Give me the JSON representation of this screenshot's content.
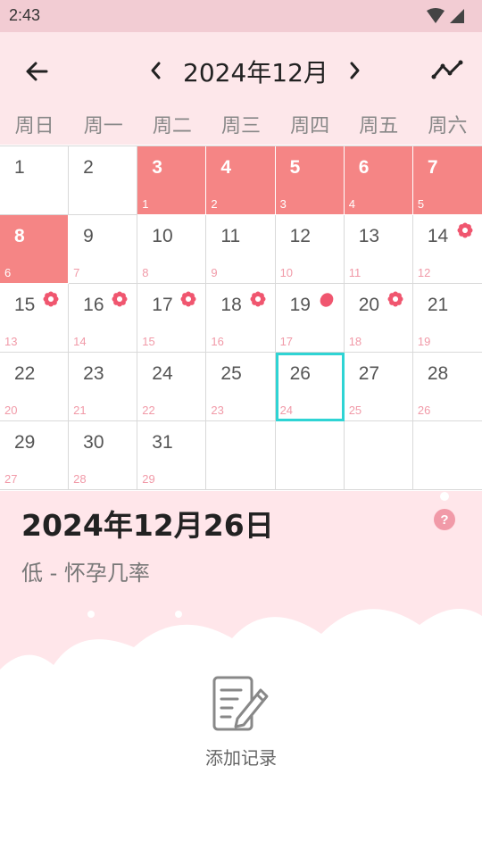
{
  "status": {
    "time": "2:43"
  },
  "header": {
    "month_title": "2024年12月"
  },
  "weekdays": [
    "周日",
    "周一",
    "周二",
    "周三",
    "周四",
    "周五",
    "周六"
  ],
  "calendar": {
    "colors": {
      "period": "#f58585",
      "today_outline": "#2fd4d4",
      "cycle_number": "#f19aa8"
    },
    "days": [
      {
        "day": "1",
        "cycle": "",
        "type": "normal",
        "mark": ""
      },
      {
        "day": "2",
        "cycle": "",
        "type": "normal",
        "mark": ""
      },
      {
        "day": "3",
        "cycle": "1",
        "type": "period",
        "mark": ""
      },
      {
        "day": "4",
        "cycle": "2",
        "type": "period",
        "mark": ""
      },
      {
        "day": "5",
        "cycle": "3",
        "type": "period",
        "mark": ""
      },
      {
        "day": "6",
        "cycle": "4",
        "type": "period",
        "mark": ""
      },
      {
        "day": "7",
        "cycle": "5",
        "type": "period",
        "mark": ""
      },
      {
        "day": "8",
        "cycle": "6",
        "type": "period",
        "mark": ""
      },
      {
        "day": "9",
        "cycle": "7",
        "type": "normal",
        "mark": ""
      },
      {
        "day": "10",
        "cycle": "8",
        "type": "normal",
        "mark": ""
      },
      {
        "day": "11",
        "cycle": "9",
        "type": "normal",
        "mark": ""
      },
      {
        "day": "12",
        "cycle": "10",
        "type": "normal",
        "mark": ""
      },
      {
        "day": "13",
        "cycle": "11",
        "type": "normal",
        "mark": ""
      },
      {
        "day": "14",
        "cycle": "12",
        "type": "normal",
        "mark": "flower-icon"
      },
      {
        "day": "15",
        "cycle": "13",
        "type": "normal",
        "mark": "flower-icon"
      },
      {
        "day": "16",
        "cycle": "14",
        "type": "normal",
        "mark": "flower-icon"
      },
      {
        "day": "17",
        "cycle": "15",
        "type": "normal",
        "mark": "flower-icon"
      },
      {
        "day": "18",
        "cycle": "16",
        "type": "normal",
        "mark": "flower-icon"
      },
      {
        "day": "19",
        "cycle": "17",
        "type": "normal",
        "mark": "ovulation-egg-icon"
      },
      {
        "day": "20",
        "cycle": "18",
        "type": "normal",
        "mark": "flower-icon"
      },
      {
        "day": "21",
        "cycle": "19",
        "type": "normal",
        "mark": ""
      },
      {
        "day": "22",
        "cycle": "20",
        "type": "normal",
        "mark": ""
      },
      {
        "day": "23",
        "cycle": "21",
        "type": "normal",
        "mark": ""
      },
      {
        "day": "24",
        "cycle": "22",
        "type": "normal",
        "mark": ""
      },
      {
        "day": "25",
        "cycle": "23",
        "type": "normal",
        "mark": ""
      },
      {
        "day": "26",
        "cycle": "24",
        "type": "today",
        "mark": ""
      },
      {
        "day": "27",
        "cycle": "25",
        "type": "normal",
        "mark": ""
      },
      {
        "day": "28",
        "cycle": "26",
        "type": "normal",
        "mark": ""
      },
      {
        "day": "29",
        "cycle": "27",
        "type": "normal",
        "mark": ""
      },
      {
        "day": "30",
        "cycle": "28",
        "type": "normal",
        "mark": ""
      },
      {
        "day": "31",
        "cycle": "29",
        "type": "normal",
        "mark": ""
      },
      {
        "day": "",
        "cycle": "",
        "type": "empty",
        "mark": ""
      },
      {
        "day": "",
        "cycle": "",
        "type": "empty",
        "mark": ""
      },
      {
        "day": "",
        "cycle": "",
        "type": "empty",
        "mark": ""
      },
      {
        "day": "",
        "cycle": "",
        "type": "empty",
        "mark": ""
      }
    ]
  },
  "detail": {
    "date": "2024年12月26日",
    "chance": "低 - 怀孕几率",
    "record_label": "添加记录"
  }
}
